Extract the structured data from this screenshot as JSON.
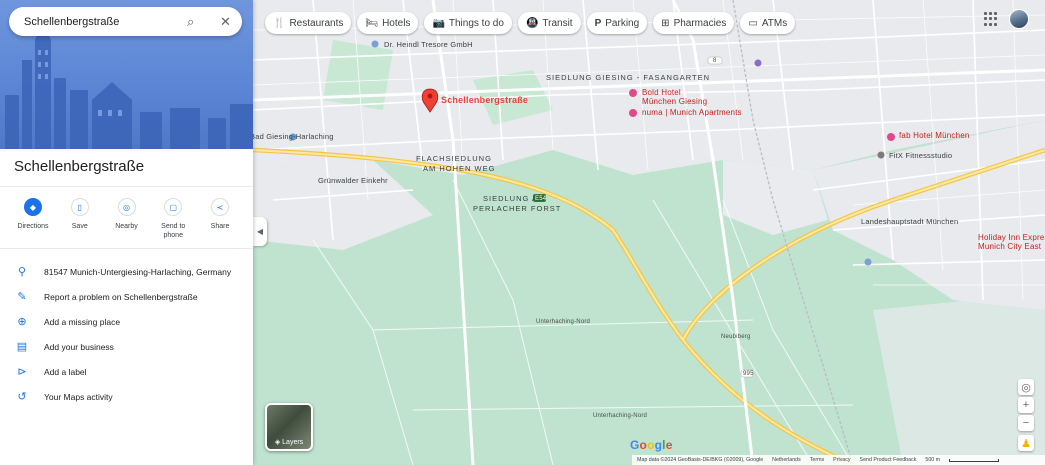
{
  "search": {
    "value": "Schellenbergstraße"
  },
  "place": {
    "title": "Schellenbergstraße",
    "address": "81547 Munich-Untergiesing-Harlaching, Germany"
  },
  "actions": [
    {
      "label": "Directions",
      "icon": "directions-icon"
    },
    {
      "label": "Save",
      "icon": "bookmark-icon"
    },
    {
      "label": "Nearby",
      "icon": "nearby-icon"
    },
    {
      "label": "Send to\nphone",
      "label_line1": "Send to",
      "label_line2": "phone",
      "icon": "phone-icon"
    },
    {
      "label": "Share",
      "icon": "share-icon"
    }
  ],
  "info_rows": [
    {
      "text": "81547 Munich-Untergiesing-Harlaching, Germany",
      "icon": "pin-icon"
    },
    {
      "text": "Report a problem on Schellenbergstraße",
      "icon": "edit-icon"
    },
    {
      "text": "Add a missing place",
      "icon": "add-place-icon"
    },
    {
      "text": "Add your business",
      "icon": "business-icon"
    },
    {
      "text": "Add a label",
      "icon": "label-icon"
    },
    {
      "text": "Your Maps activity",
      "icon": "history-icon"
    }
  ],
  "chips": [
    {
      "label": "Restaurants",
      "icon": "restaurant-icon"
    },
    {
      "label": "Hotels",
      "icon": "hotel-icon"
    },
    {
      "label": "Things to do",
      "icon": "camera-icon"
    },
    {
      "label": "Transit",
      "icon": "transit-icon"
    },
    {
      "label": "Parking",
      "icon": "parking-icon"
    },
    {
      "label": "Pharmacies",
      "icon": "pharmacy-icon"
    },
    {
      "label": "ATMs",
      "icon": "atm-icon"
    }
  ],
  "map": {
    "pin_label": "Schellenbergstraße",
    "labels": {
      "heindl": "Dr. Heindl Tresore GmbH",
      "bold": "Bold Hotel\nMünchen Giesing",
      "bold1": "Bold Hotel",
      "bold2": "München Giesing",
      "numa": "numa | Munich Apartments",
      "bad_giesing": "Bad Giesing-Harlaching",
      "gruenwalder": "Grünwalder Einkehr",
      "siedlung": "SIEDLUNG GIESING - FASANGARTEN",
      "flachsiedlung1": "FLACHSIEDLUNG",
      "flachsiedlung2": "AM HOHEN WEG",
      "siedlung_forst1": "SIEDLUNG AM",
      "siedlung_forst2": "PERLACHER FORST",
      "fab": "fab Hotel München",
      "fitx": "FitX Fitnessstudio",
      "landeshaupt": "Landeshauptstadt München",
      "holiday": "Holiday Inn Express\nMunich City East",
      "holiday1": "Holiday Inn Express",
      "holiday2": "Munich City East",
      "road_e54": "E54",
      "road_8": "8",
      "road_995": "995",
      "unterhaching1": "Unterhaching-Nord",
      "unterhaching2": "Unterhaching-Nord",
      "neubiberg": "Neubiberg"
    },
    "layers_label": "Layers",
    "footer": {
      "map_data": "Map data ©2024 GeoBasis-DE/BKG (©2009), Google",
      "country": "Netherlands",
      "terms": "Terms",
      "privacy": "Privacy",
      "feedback": "Send Product Feedback",
      "scale": "500 m"
    },
    "colors": {
      "park": "#bfe3cf",
      "urban": "#e8eaed",
      "highway": "#f7d774",
      "pin": "#ea4335"
    }
  }
}
